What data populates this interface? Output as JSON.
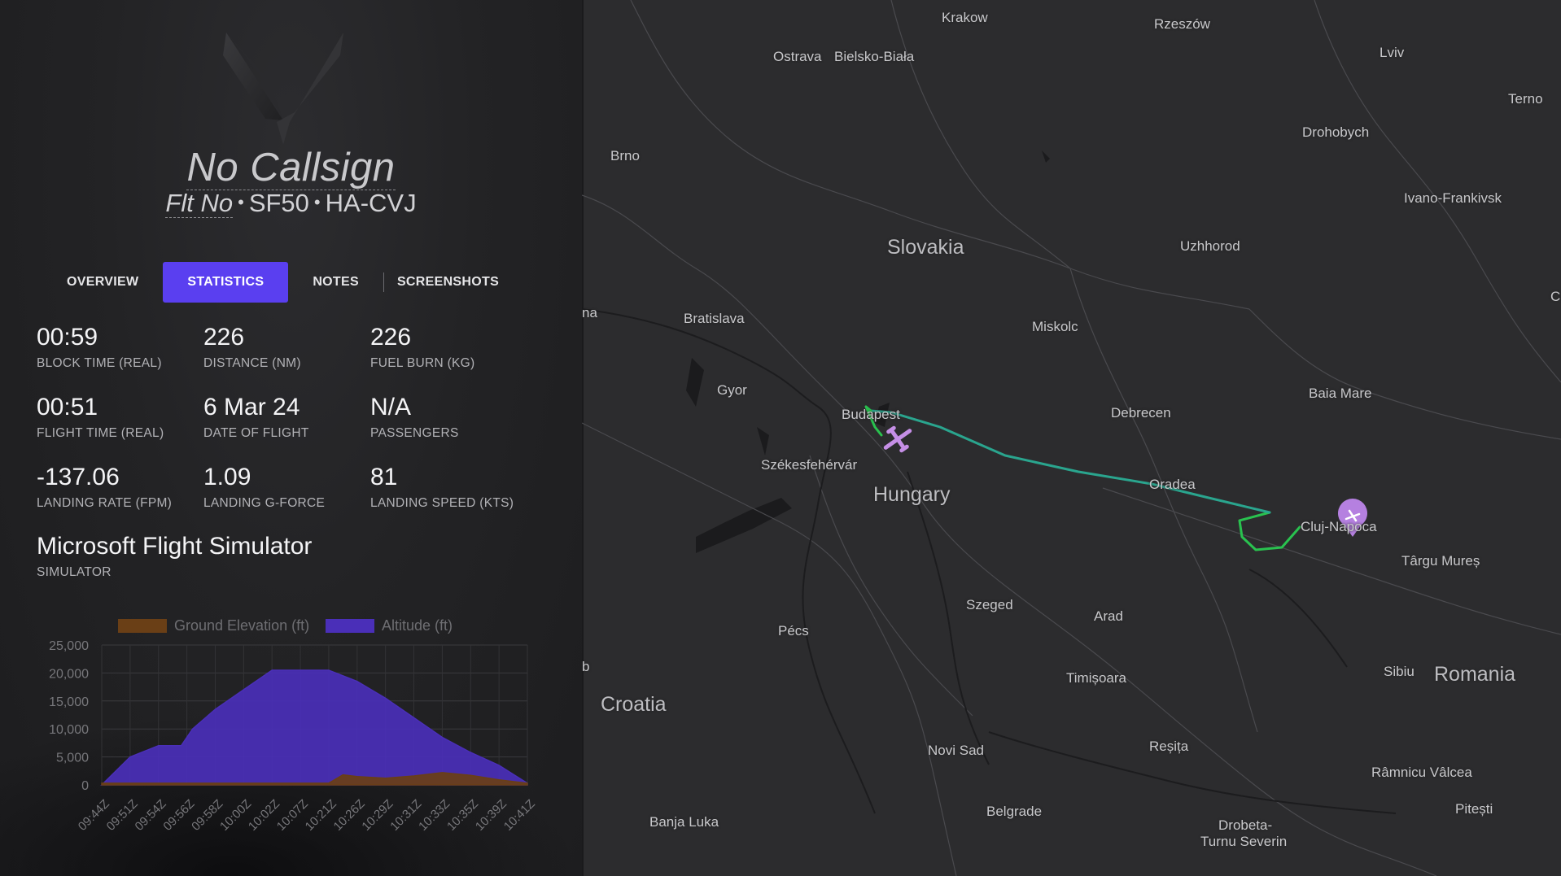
{
  "header": {
    "callsign": "No Callsign",
    "flight_number": "Flt No",
    "aircraft_type": "SF50",
    "registration": "HA-CVJ",
    "separator": "•"
  },
  "tabs": [
    {
      "label": "OVERVIEW",
      "active": false
    },
    {
      "label": "STATISTICS",
      "active": true
    },
    {
      "label": "NOTES",
      "active": false
    },
    {
      "label": "SCREENSHOTS",
      "active": false
    }
  ],
  "stats": [
    {
      "value": "00:59",
      "label": "BLOCK TIME (REAL)"
    },
    {
      "value": "226",
      "label": "DISTANCE (NM)"
    },
    {
      "value": "226",
      "label": "FUEL BURN (KG)"
    },
    {
      "value": "00:51",
      "label": "FLIGHT TIME (REAL)"
    },
    {
      "value": "6 Mar 24",
      "label": "DATE OF FLIGHT"
    },
    {
      "value": "N/A",
      "label": "PASSENGERS"
    },
    {
      "value": "-137.06",
      "label": "LANDING RATE (FPM)"
    },
    {
      "value": "1.09",
      "label": "LANDING G-FORCE"
    },
    {
      "value": "81",
      "label": "LANDING SPEED (KTS)"
    }
  ],
  "simulator": {
    "value": "Microsoft Flight Simulator",
    "label": "SIMULATOR"
  },
  "colors": {
    "accent": "#5a3ff0",
    "altitude": "#4a2fb8",
    "ground": "#6a3f16",
    "route_flown": "#2aa58e",
    "route_start": "#29c24f",
    "destination_pin": "#b580e0"
  },
  "chart_data": {
    "type": "area",
    "legend": [
      "Ground Elevation (ft)",
      "Altitude (ft)"
    ],
    "legend_position": "top",
    "y_ticks": [
      "25,000",
      "20,000",
      "15,000",
      "10,000",
      "5,000",
      "0"
    ],
    "ylim": [
      0,
      25000
    ],
    "x_ticks": [
      "09:44Z",
      "09:51Z",
      "09:54Z",
      "09:56Z",
      "09:58Z",
      "10:00Z",
      "10:02Z",
      "10:07Z",
      "10:21Z",
      "10:26Z",
      "10:29Z",
      "10:31Z",
      "10:33Z",
      "10:35Z",
      "10:39Z",
      "10:41Z"
    ],
    "series": [
      {
        "name": "Altitude (ft)",
        "x": [
          0,
          1,
          2,
          2.8,
          3.2,
          4,
          5,
          6,
          6.5,
          7,
          8,
          9,
          10,
          11,
          12,
          13,
          14,
          15
        ],
        "values": [
          0,
          5000,
          7000,
          7000,
          10000,
          13500,
          17000,
          20500,
          20500,
          20500,
          20500,
          18500,
          15500,
          12000,
          8500,
          5800,
          3500,
          300
        ]
      },
      {
        "name": "Ground Elevation (ft)",
        "x": [
          0,
          2,
          4,
          6,
          8,
          8.5,
          9,
          10,
          11,
          12,
          13,
          14,
          15
        ],
        "values": [
          300,
          300,
          300,
          300,
          300,
          1800,
          1500,
          1200,
          1600,
          2200,
          1700,
          900,
          300
        ]
      }
    ]
  },
  "map": {
    "labels": [
      {
        "name": "Krakow",
        "type": "city"
      },
      {
        "name": "Rzeszów",
        "type": "city"
      },
      {
        "name": "Ostrava",
        "type": "city"
      },
      {
        "name": "Bielsko-Biała",
        "type": "city"
      },
      {
        "name": "Lviv",
        "type": "city"
      },
      {
        "name": "Terno",
        "type": "city"
      },
      {
        "name": "Drohobych",
        "type": "city"
      },
      {
        "name": "Brno",
        "type": "city"
      },
      {
        "name": "Ivano-Frankivsk",
        "type": "city"
      },
      {
        "name": "Slovakia",
        "type": "country"
      },
      {
        "name": "Uzhhorod",
        "type": "city"
      },
      {
        "name": "na",
        "type": "city"
      },
      {
        "name": "Bratislava",
        "type": "city"
      },
      {
        "name": "Miskolc",
        "type": "city"
      },
      {
        "name": "C",
        "type": "city"
      },
      {
        "name": "Baia Mare",
        "type": "city"
      },
      {
        "name": "Gyor",
        "type": "city"
      },
      {
        "name": "Budapest",
        "type": "city"
      },
      {
        "name": "Debrecen",
        "type": "city"
      },
      {
        "name": "Székesfehérvár",
        "type": "city"
      },
      {
        "name": "Oradea",
        "type": "city"
      },
      {
        "name": "Hungary",
        "type": "country"
      },
      {
        "name": "Cluj-Napoca",
        "type": "city"
      },
      {
        "name": "Târgu Mureș",
        "type": "city"
      },
      {
        "name": "Szeged",
        "type": "city"
      },
      {
        "name": "Arad",
        "type": "city"
      },
      {
        "name": "Pécs",
        "type": "city"
      },
      {
        "name": "Timișoara",
        "type": "city"
      },
      {
        "name": "Sibiu",
        "type": "city"
      },
      {
        "name": "Romania",
        "type": "country"
      },
      {
        "name": "b",
        "type": "city"
      },
      {
        "name": "Croatia",
        "type": "country"
      },
      {
        "name": "Reșița",
        "type": "city"
      },
      {
        "name": "Novi Sad",
        "type": "city"
      },
      {
        "name": "Râmnicu Vâlcea",
        "type": "city"
      },
      {
        "name": "Banja Luka",
        "type": "city"
      },
      {
        "name": "Belgrade",
        "type": "city"
      },
      {
        "name": "Pitești",
        "type": "city"
      },
      {
        "name": "Drobeta-",
        "type": "city"
      },
      {
        "name": "Turnu Severin",
        "type": "city"
      }
    ]
  }
}
